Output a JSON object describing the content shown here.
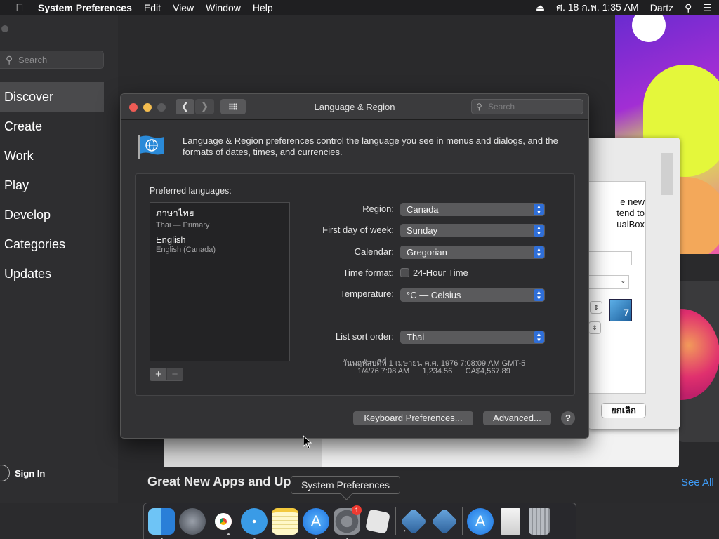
{
  "menubar": {
    "apple_icon": "apple-icon",
    "app_name": "System Preferences",
    "items": [
      "Edit",
      "View",
      "Window",
      "Help"
    ],
    "date_time": "ศ. 18 ก.พ. 1:35 AM",
    "user": "Dartz"
  },
  "app_store": {
    "search_placeholder": "Search",
    "nav": [
      "Discover",
      "Create",
      "Work",
      "Play",
      "Develop",
      "Categories",
      "Updates"
    ],
    "sign_in": "Sign In",
    "section_title": "Great New Apps and Updates",
    "see_all": "See All"
  },
  "vbox": {
    "text_lines": [
      "e new",
      "tend to",
      "ualBox"
    ],
    "cancel": "ยกเลิก",
    "icon_text": "7"
  },
  "window": {
    "title": "Language & Region",
    "search_placeholder": "Search",
    "description": "Language & Region preferences control the language you see in menus and dialogs, and the formats of dates, times, and currencies.",
    "preferred_label": "Preferred languages:",
    "languages": [
      {
        "name": "ภาษาไทย",
        "detail": "Thai — Primary"
      },
      {
        "name": "English",
        "detail": "English (Canada)"
      }
    ],
    "add": "+",
    "remove": "−",
    "region_label": "Region:",
    "region_value": "Canada",
    "first_day_label": "First day of week:",
    "first_day_value": "Sunday",
    "calendar_label": "Calendar:",
    "calendar_value": "Gregorian",
    "time_format_label": "Time format:",
    "time_format_option": "24-Hour Time",
    "temperature_label": "Temperature:",
    "temperature_value": "°C — Celsius",
    "sort_label": "List sort order:",
    "sort_value": "Thai",
    "sample_line1": "วันพฤหัสบดีที่ 1 เมษายน ค.ศ. 1976 7:08:09 AM GMT-5",
    "sample_line2": "1/4/76 7:08 AM      1,234.56      CA$4,567.89",
    "keyboard_button": "Keyboard Preferences...",
    "advanced_button": "Advanced...",
    "help": "?"
  },
  "dock": {
    "tooltip": "System Preferences",
    "badge": "1",
    "apps": [
      "finder-icon",
      "launchpad-icon",
      "chrome-icon",
      "safari-icon",
      "notes-icon",
      "app-store-icon",
      "system-preferences-icon",
      "roblox-icon",
      "virtualbox-icon",
      "virtualbox-vm-icon",
      "app-store-downloads-icon",
      "document-icon",
      "trash-icon"
    ]
  },
  "colors": {
    "accent": "#2f6fd9",
    "link": "#3f9cf7",
    "close": "#ee5c55",
    "minimize": "#f4bd4f"
  }
}
